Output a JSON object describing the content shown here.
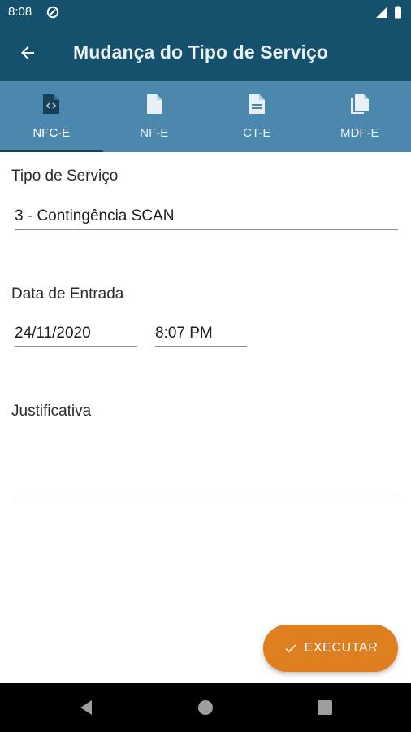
{
  "status_bar": {
    "time": "8:08",
    "left_icon": "data-saver-icon",
    "right_icons": [
      "signal-icon",
      "battery-icon"
    ]
  },
  "app_bar": {
    "back_icon": "arrow-back-icon",
    "title": "Mudança do Tipo de Serviço",
    "background": "#15516d"
  },
  "tabs": {
    "background": "#4c88ad",
    "items": [
      {
        "label": "NFC-E",
        "icon": "code-document-icon",
        "active": true
      },
      {
        "label": "NF-E",
        "icon": "document-icon",
        "active": false
      },
      {
        "label": "CT-E",
        "icon": "text-document-icon",
        "active": false
      },
      {
        "label": "MDF-E",
        "icon": "stacked-documents-icon",
        "active": false
      }
    ]
  },
  "form": {
    "service_type": {
      "label": "Tipo de Serviço",
      "value": "3 - Contingência SCAN"
    },
    "entry_date": {
      "label": "Data de Entrada",
      "date": "24/11/2020",
      "time": "8:07 PM"
    },
    "justification": {
      "label": "Justificativa",
      "value": ""
    }
  },
  "fab": {
    "label": "EXECUTAR",
    "icon": "check-icon",
    "color": "#e07f1f"
  },
  "nav_bar": {
    "icons": [
      "back-triangle-icon",
      "home-circle-icon",
      "recents-square-icon"
    ]
  }
}
